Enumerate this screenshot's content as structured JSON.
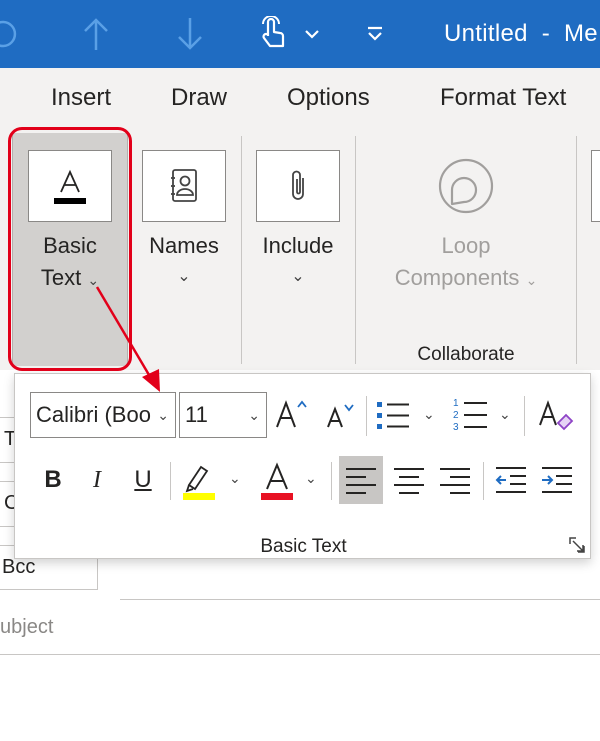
{
  "titlebar": {
    "title": "Untitled  -  Me",
    "buttons": [
      "undo-icon",
      "arrow-up-icon",
      "arrow-down-icon",
      "touch-mode-icon",
      "customize-qat-icon"
    ],
    "bg_color": "#1f6cc2"
  },
  "ribbon": {
    "tabs": [
      "Insert",
      "Draw",
      "Options",
      "Format Text"
    ],
    "groups": {
      "basic_text": {
        "label_line1": "Basic",
        "label_line2": "Text"
      },
      "names": {
        "label": "Names"
      },
      "include": {
        "label": "Include"
      },
      "loop": {
        "label_line1": "Loop",
        "label_line2": "Components",
        "disabled": true
      },
      "collaborate": {
        "label": "Collaborate"
      }
    },
    "highlight_color": "#e2001a"
  },
  "compose": {
    "to_label": "T",
    "cc_label": "C",
    "bcc_label": "Bcc",
    "subject_placeholder": "ubject"
  },
  "popup": {
    "font_name": "Calibri (Boo",
    "font_size": "11",
    "title": "Basic Text",
    "highlight_color": "#ffff00",
    "font_color": "#e81123",
    "alignment_selected": "left",
    "icons": [
      "grow-font-icon",
      "shrink-font-icon",
      "bullets-icon",
      "numbering-icon",
      "clear-formatting-icon",
      "bold-icon",
      "italic-icon",
      "underline-icon",
      "highlight-icon",
      "font-color-icon",
      "align-left-icon",
      "align-center-icon",
      "align-right-icon",
      "decrease-indent-icon",
      "increase-indent-icon",
      "dialog-launcher-icon"
    ],
    "bold": "B",
    "italic": "I",
    "underline": "U"
  }
}
